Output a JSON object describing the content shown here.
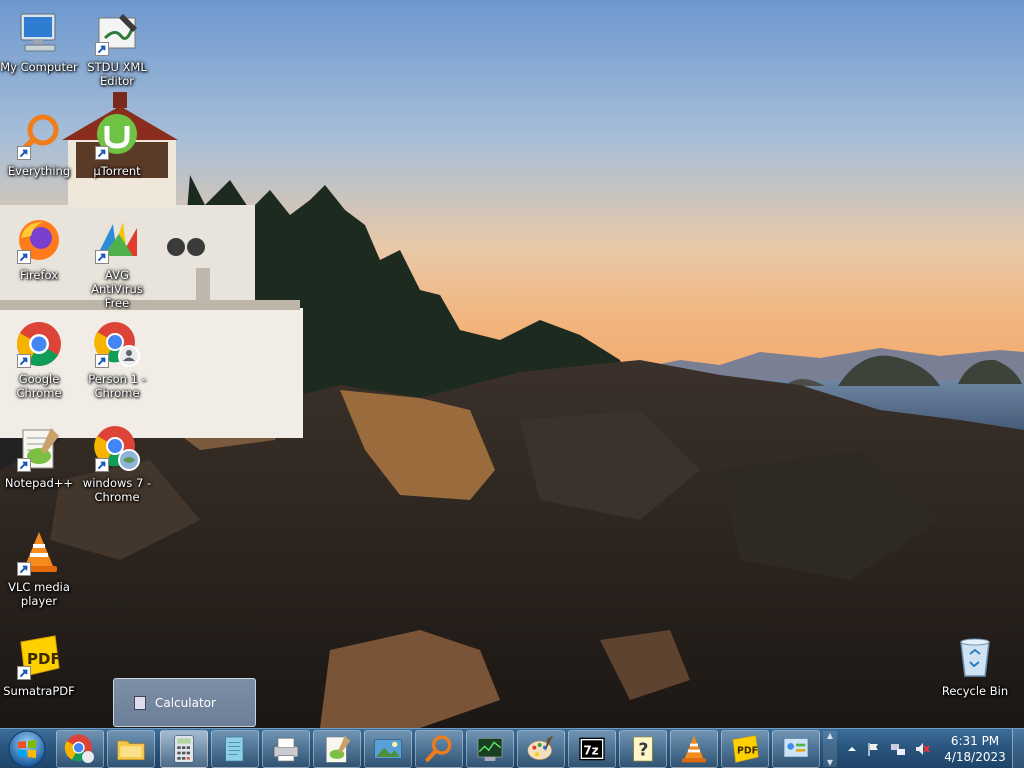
{
  "desktop": {
    "icons": [
      {
        "label": "My Computer",
        "icon": "computer-icon"
      },
      {
        "label": "STDU XML Editor",
        "icon": "xml-editor-icon"
      },
      {
        "label": "Everything",
        "icon": "everything-search-icon"
      },
      {
        "label": "µTorrent",
        "icon": "utorrent-icon"
      },
      {
        "label": "Firefox",
        "icon": "firefox-icon"
      },
      {
        "label": "AVG AntiVirus Free",
        "icon": "avg-icon"
      },
      {
        "label": "Google Chrome",
        "icon": "chrome-icon"
      },
      {
        "label": "Person 1 - Chrome",
        "icon": "chrome-profile-icon"
      },
      {
        "label": "Notepad++",
        "icon": "notepadpp-icon"
      },
      {
        "label": "windows 7 - Chrome",
        "icon": "chrome-profile-icon"
      },
      {
        "label": "VLC media player",
        "icon": "vlc-icon"
      },
      {
        "label": "SumatraPDF",
        "icon": "sumatrapdf-icon"
      },
      {
        "label": "Recycle Bin",
        "icon": "recycle-bin-icon"
      }
    ]
  },
  "preview": {
    "label": "Calculator"
  },
  "taskbar": {
    "buttons": [
      {
        "icon": "chrome-icon"
      },
      {
        "icon": "file-explorer-icon"
      },
      {
        "icon": "calculator-icon"
      },
      {
        "icon": "notepad-icon"
      },
      {
        "icon": "fax-printer-icon"
      },
      {
        "icon": "notepadpp-icon"
      },
      {
        "icon": "photo-viewer-icon"
      },
      {
        "icon": "everything-search-icon"
      },
      {
        "icon": "task-manager-icon"
      },
      {
        "icon": "paint-icon"
      },
      {
        "icon": "7zip-icon"
      },
      {
        "icon": "help-icon"
      },
      {
        "icon": "vlc-icon"
      },
      {
        "icon": "sumatrapdf-icon"
      },
      {
        "icon": "control-panel-icon"
      }
    ],
    "sevenzip_text": "7z",
    "sumatra_text": "PDF"
  },
  "tray": {
    "time": "6:31 PM",
    "date": "4/18/2023"
  },
  "colors": {
    "taskbar": "#2a577f",
    "sky_top": "#6f9ad1",
    "sky_bottom": "#f0b37a"
  }
}
